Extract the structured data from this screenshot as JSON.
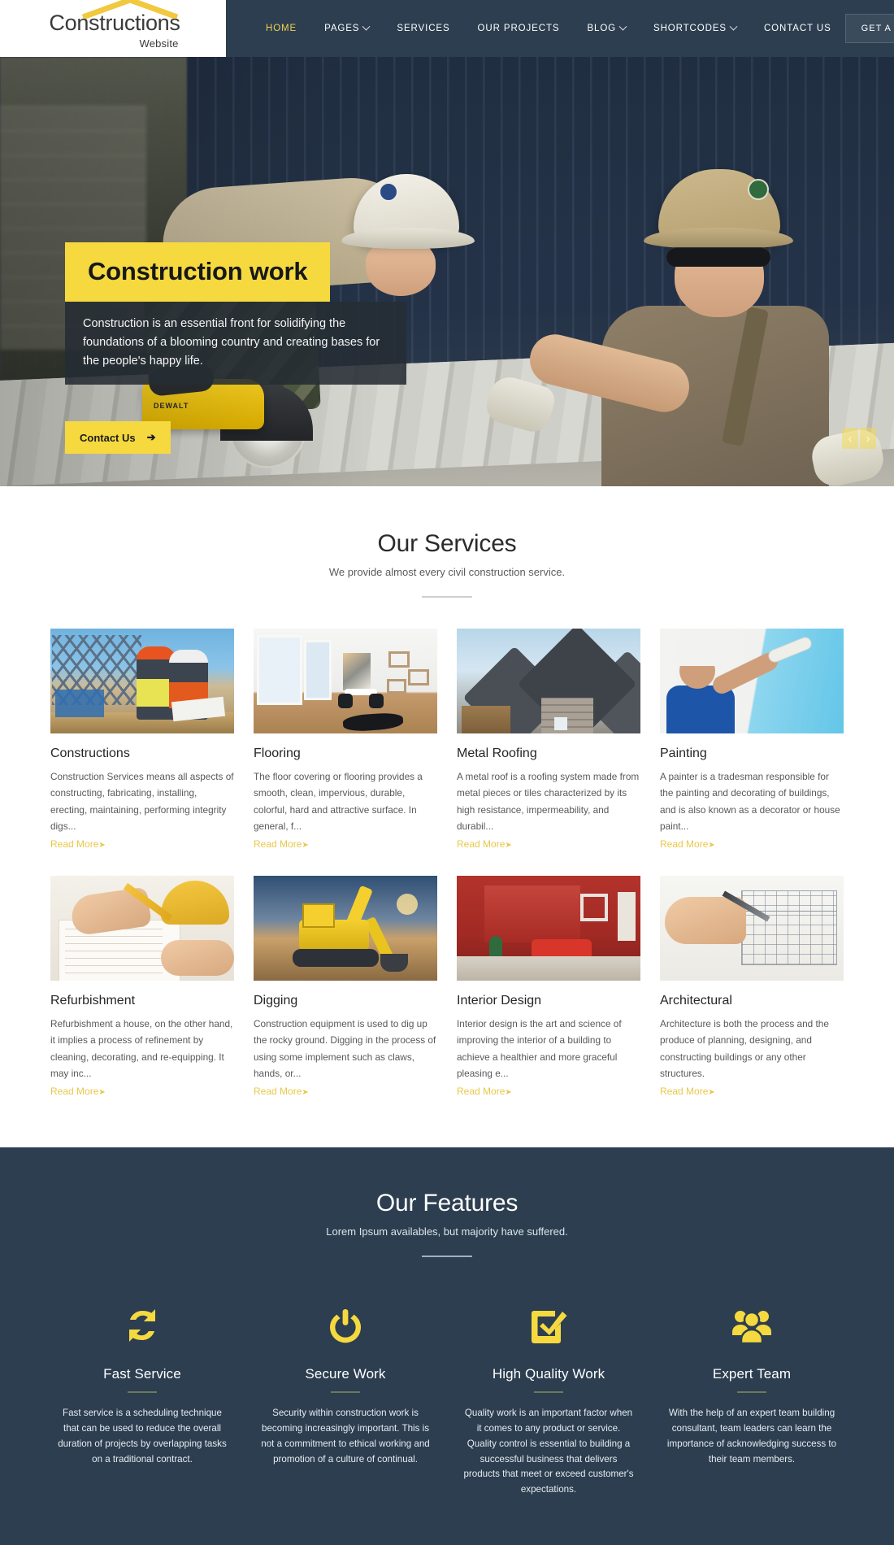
{
  "header": {
    "logo": {
      "main": "Constructions",
      "sub": "Website",
      "icon": "roof-chevron-icon",
      "accent": "#f0c93f"
    },
    "nav": [
      {
        "label": "HOME",
        "active": true,
        "caret": false
      },
      {
        "label": "PAGES",
        "active": false,
        "caret": true
      },
      {
        "label": "SERVICES",
        "active": false,
        "caret": false
      },
      {
        "label": "OUR PROJECTS",
        "active": false,
        "caret": false
      },
      {
        "label": "BLOG",
        "active": false,
        "caret": true
      },
      {
        "label": "SHORTCODES",
        "active": false,
        "caret": true
      },
      {
        "label": "CONTACT US",
        "active": false,
        "caret": false
      }
    ],
    "quote_button": "GET A QUOTE",
    "bg_color": "#2c3e50"
  },
  "hero": {
    "title": "Construction work",
    "description": "Construction is an essential front for solidifying the foundations of a blooming country and creating bases for the people's happy life.",
    "cta_label": "Contact Us",
    "cta_arrow": "➔",
    "prev_arrow": "‹",
    "next_arrow": "›",
    "title_bg": "#f5d93f",
    "saw_brand": "DEWALT"
  },
  "services": {
    "title": "Our Services",
    "subtitle": "We provide almost every civil construction service.",
    "read_more": "Read More",
    "read_more_arrow": "➤",
    "items": [
      {
        "title": "Constructions",
        "text": "Construction Services means all aspects of constructing, fabricating, installing, erecting, maintaining, performing integrity digs...",
        "image": "construction-site-workers-image"
      },
      {
        "title": "Flooring",
        "text": "The floor covering or flooring provides a smooth, clean, impervious, durable, colorful, hard and attractive surface. In general, f...",
        "image": "interior-room-flooring-image"
      },
      {
        "title": "Metal Roofing",
        "text": "A metal roof is a roofing system made from metal pieces or tiles characterized by its high resistance, impermeability, and durabil...",
        "image": "metal-roof-gables-image"
      },
      {
        "title": "Painting",
        "text": "A painter is a tradesman responsible for the painting and decorating of buildings, and is also known as a decorator or house paint...",
        "image": "painter-with-roller-image"
      },
      {
        "title": "Refurbishment",
        "text": "Refurbishment a house, on the other hand, it implies a process of refinement by cleaning, decorating, and re-equipping. It may inc...",
        "image": "blueprint-drawing-hands-image"
      },
      {
        "title": "Digging",
        "text": "Construction equipment is used to dig up the rocky ground. Digging in the process of using some implement such as claws, hands, or...",
        "image": "excavator-at-sunset-image"
      },
      {
        "title": "Interior Design",
        "text": "Interior design is the art and science of improving the interior of a building to achieve a healthier and more graceful pleasing e...",
        "image": "red-living-room-image"
      },
      {
        "title": "Architectural",
        "text": "Architecture is both the process and the produce of planning, designing, and constructing buildings or any other structures.",
        "image": "architect-sketching-house-image"
      }
    ]
  },
  "features": {
    "title": "Our Features",
    "subtitle": "Lorem Ipsum availables, but majority have suffered.",
    "accent": "#f5d93f",
    "bg_color": "#2c3e50",
    "items": [
      {
        "title": "Fast Service",
        "icon": "refresh-cycle-icon",
        "text": "Fast service is a scheduling technique that can be used to reduce the overall duration of projects by overlapping tasks on a traditional contract."
      },
      {
        "title": "Secure Work",
        "icon": "power-button-icon",
        "text": "Security within construction work is becoming increasingly important. This is not a commitment to ethical working and promotion of a culture of continual."
      },
      {
        "title": "High Quality Work",
        "icon": "check-square-icon",
        "text": "Quality work is an important factor when it comes to any product or service. Quality control is essential to building a successful business that delivers products that meet or exceed customer's expectations."
      },
      {
        "title": "Expert Team",
        "icon": "users-group-icon",
        "text": "With the help of an expert team building consultant, team leaders can learn the importance of acknowledging success to their team members."
      }
    ]
  }
}
